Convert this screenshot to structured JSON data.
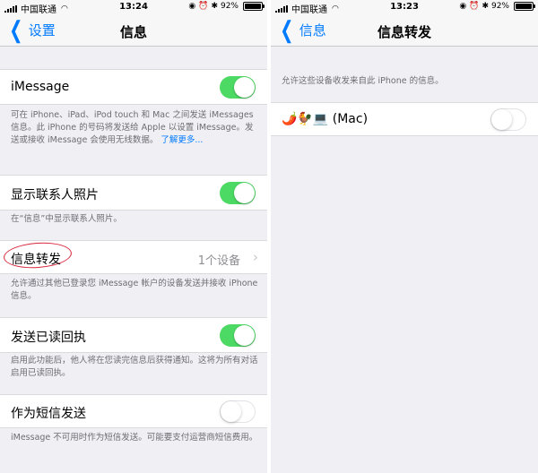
{
  "left": {
    "status": {
      "carrier": "中国联通",
      "time": "13:24",
      "battery": "92%",
      "battery_level": 0.92
    },
    "nav": {
      "back": "设置",
      "title": "信息"
    },
    "imessage": {
      "label": "iMessage",
      "on": true
    },
    "imessage_footer": {
      "text": "可在 iPhone、iPad、iPod touch 和 Mac 之间发送 iMessages 信息。此 iPhone 的号码将发送给 Apple 以设置 iMessage。发送或接收 iMessage 会使用无线数据。",
      "link": "了解更多..."
    },
    "contact_photos": {
      "label": "显示联系人照片",
      "on": true
    },
    "contact_photos_footer": "在“信息”中显示联系人照片。",
    "forwarding": {
      "label": "信息转发",
      "value": "1个设备"
    },
    "forwarding_footer": "允许通过其他已登录您 iMessage 帐户的设备发送并接收 iPhone 信息。",
    "read_receipts": {
      "label": "发送已读回执",
      "on": true
    },
    "read_receipts_footer": "启用此功能后，他人将在您读完信息后获得通知。这将为所有对话启用已读回执。",
    "send_sms": {
      "label": "作为短信发送",
      "on": false
    },
    "send_sms_footer": "iMessage 不可用时作为短信发送。可能要支付运营商短信费用。"
  },
  "right": {
    "status": {
      "carrier": "中国联通",
      "time": "13:23",
      "battery": "92%",
      "battery_level": 0.92
    },
    "nav": {
      "back": "信息",
      "title": "信息转发"
    },
    "header": "允许这些设备收发来自此 iPhone 的信息。",
    "device": {
      "label": "🌶️🐓💻 (Mac)",
      "on": false
    }
  },
  "colors": {
    "accent": "#007aff",
    "toggle_on": "#4cd964",
    "annotation": "#d7263d"
  }
}
